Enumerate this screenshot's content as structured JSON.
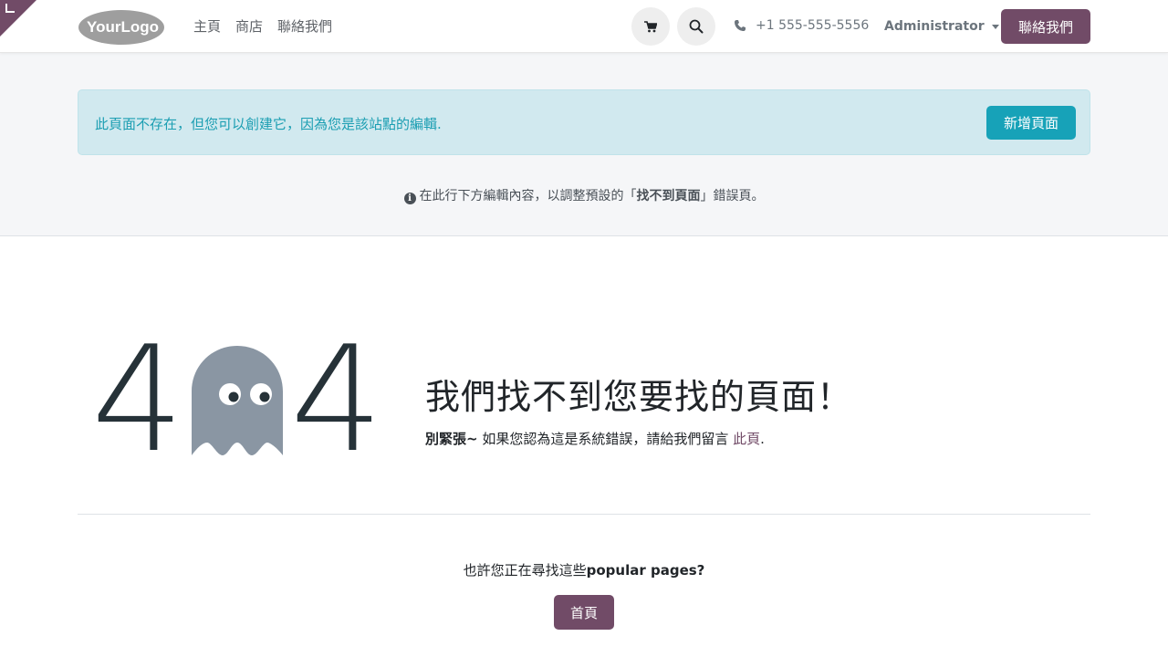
{
  "header": {
    "logo_text": "YourLogo",
    "nav": [
      "主頁",
      "商店",
      "聯絡我們"
    ],
    "phone": "+1 555-555-5556",
    "user": "Administrator",
    "contact_button": "聯絡我們"
  },
  "alert": {
    "message": "此頁面不存在，但您可以創建它，因為您是該站點的編輯.",
    "button": "新增頁面"
  },
  "hint": {
    "prefix": "在此行下方編輯內容，以調整預設的「",
    "bold": "找不到頁面",
    "suffix": "」錯誤頁。"
  },
  "error": {
    "digit_left": "4",
    "digit_right": "4",
    "headline": "我們找不到您要找的頁面！",
    "sub_bold": "別緊張~",
    "sub_text": " 如果您認為這是系統錯誤，請給我們留言 ",
    "sub_link": "此頁",
    "sub_end": "."
  },
  "popular": {
    "prefix": "也許您正在尋找這些",
    "bold": "popular pages?",
    "home_button": "首頁"
  },
  "colors": {
    "primary": "#714b67",
    "info": "#17a2b8",
    "alert_bg": "#d1e9ef",
    "ghost": "#8a96a3",
    "dark": "#263238"
  }
}
